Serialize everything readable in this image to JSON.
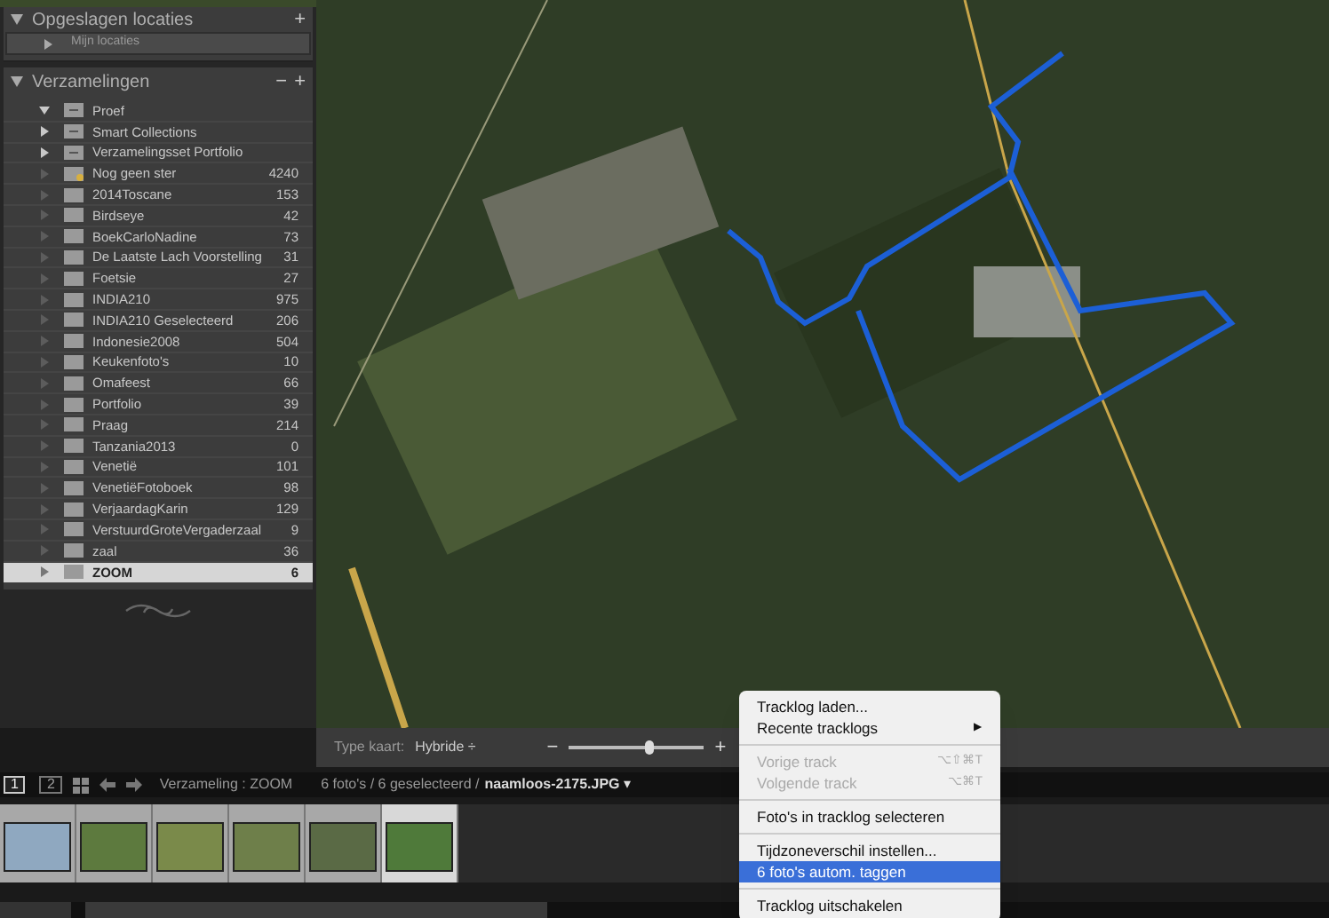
{
  "left_panel": {
    "saved_locations": {
      "title": "Opgeslagen locaties",
      "add": "+",
      "items": [
        {
          "label": "Mijn locaties",
          "expanded": false
        }
      ]
    },
    "collections": {
      "title": "Verzamelingen",
      "remove": "−",
      "add": "+",
      "items": [
        {
          "kind": "set",
          "label": "Proef",
          "expanded": true,
          "selected": false
        },
        {
          "kind": "set",
          "label": "Smart Collections",
          "expanded": false,
          "selected": false
        },
        {
          "kind": "set",
          "label": "Verzamelingsset Portfolio",
          "expanded": false,
          "selected": false
        },
        {
          "kind": "smart",
          "label": "Nog geen ster",
          "count": "4240",
          "selected": false
        },
        {
          "kind": "collection",
          "label": "2014Toscane",
          "count": "153",
          "selected": false
        },
        {
          "kind": "collection",
          "label": "Birdseye",
          "count": "42",
          "selected": false
        },
        {
          "kind": "collection",
          "label": "BoekCarloNadine",
          "count": "73",
          "selected": false
        },
        {
          "kind": "collection",
          "label": "De Laatste Lach Voorstelling",
          "count": "31",
          "selected": false
        },
        {
          "kind": "collection",
          "label": "Foetsie",
          "count": "27",
          "selected": false
        },
        {
          "kind": "collection",
          "label": "INDIA210",
          "count": "975",
          "selected": false
        },
        {
          "kind": "collection",
          "label": "INDIA210 Geselecteerd",
          "count": "206",
          "selected": false
        },
        {
          "kind": "collection",
          "label": "Indonesie2008",
          "count": "504",
          "selected": false
        },
        {
          "kind": "collection",
          "label": "Keukenfoto's",
          "count": "10",
          "selected": false
        },
        {
          "kind": "collection",
          "label": "Omafeest",
          "count": "66",
          "selected": false
        },
        {
          "kind": "collection",
          "label": "Portfolio",
          "count": "39",
          "selected": false
        },
        {
          "kind": "collection",
          "label": "Praag",
          "count": "214",
          "selected": false
        },
        {
          "kind": "collection",
          "label": "Tanzania2013",
          "count": "0",
          "selected": false
        },
        {
          "kind": "collection",
          "label": "Venetië",
          "count": "101",
          "selected": false
        },
        {
          "kind": "collection",
          "label": "VenetiëFotoboek",
          "count": "98",
          "selected": false
        },
        {
          "kind": "collection",
          "label": "VerjaardagKarin",
          "count": "129",
          "selected": false
        },
        {
          "kind": "collection",
          "label": "VerstuurdGroteVergaderzaal",
          "count": "9",
          "selected": false
        },
        {
          "kind": "collection",
          "label": "zaal",
          "count": "36",
          "selected": false
        },
        {
          "kind": "collection",
          "label": "ZOOM",
          "count": "6",
          "selected": true
        }
      ]
    }
  },
  "map_toolbar": {
    "map_type_label": "Type kaart:",
    "map_type": "Hybride ÷",
    "zoom_out": "−",
    "zoom_in": "+",
    "zoom": {
      "level": 0.6
    }
  },
  "filmstrip_bar": {
    "view_buttons": [
      {
        "label": "1",
        "selected": true
      },
      {
        "label": "2",
        "selected": false
      }
    ],
    "source": "Verzameling : ZOOM",
    "info": "6 foto's / 6 geselecteerd /",
    "filename": "naamloos-2175.JPG",
    "dropdown": "▾"
  },
  "filmstrip": {
    "thumbnails": [
      {
        "active": false
      },
      {
        "active": false
      },
      {
        "active": false
      },
      {
        "active": false
      },
      {
        "active": false
      },
      {
        "active": true
      }
    ]
  },
  "context_menu": {
    "items": [
      {
        "kind": "item",
        "label": "Tracklog laden...",
        "disabled": false,
        "highlighted": false
      },
      {
        "kind": "submenu",
        "label": "Recente tracklogs",
        "arrow": "▶",
        "disabled": false,
        "highlighted": false
      },
      {
        "kind": "separator"
      },
      {
        "kind": "item",
        "label": "Vorige track",
        "shortcut": "⌥⇧⌘T",
        "disabled": true,
        "highlighted": false
      },
      {
        "kind": "item",
        "label": "Volgende track",
        "shortcut": "⌥⌘T",
        "disabled": true,
        "highlighted": false
      },
      {
        "kind": "separator"
      },
      {
        "kind": "item",
        "label": "Foto's in tracklog selecteren",
        "disabled": false,
        "highlighted": false
      },
      {
        "kind": "separator"
      },
      {
        "kind": "item",
        "label": "Tijdzoneverschil instellen...",
        "disabled": false,
        "highlighted": false
      },
      {
        "kind": "item",
        "label": "6 foto's autom. taggen",
        "disabled": false,
        "highlighted": true
      },
      {
        "kind": "separator"
      },
      {
        "kind": "item",
        "label": "Tracklog uitschakelen",
        "disabled": false,
        "highlighted": false
      }
    ]
  }
}
